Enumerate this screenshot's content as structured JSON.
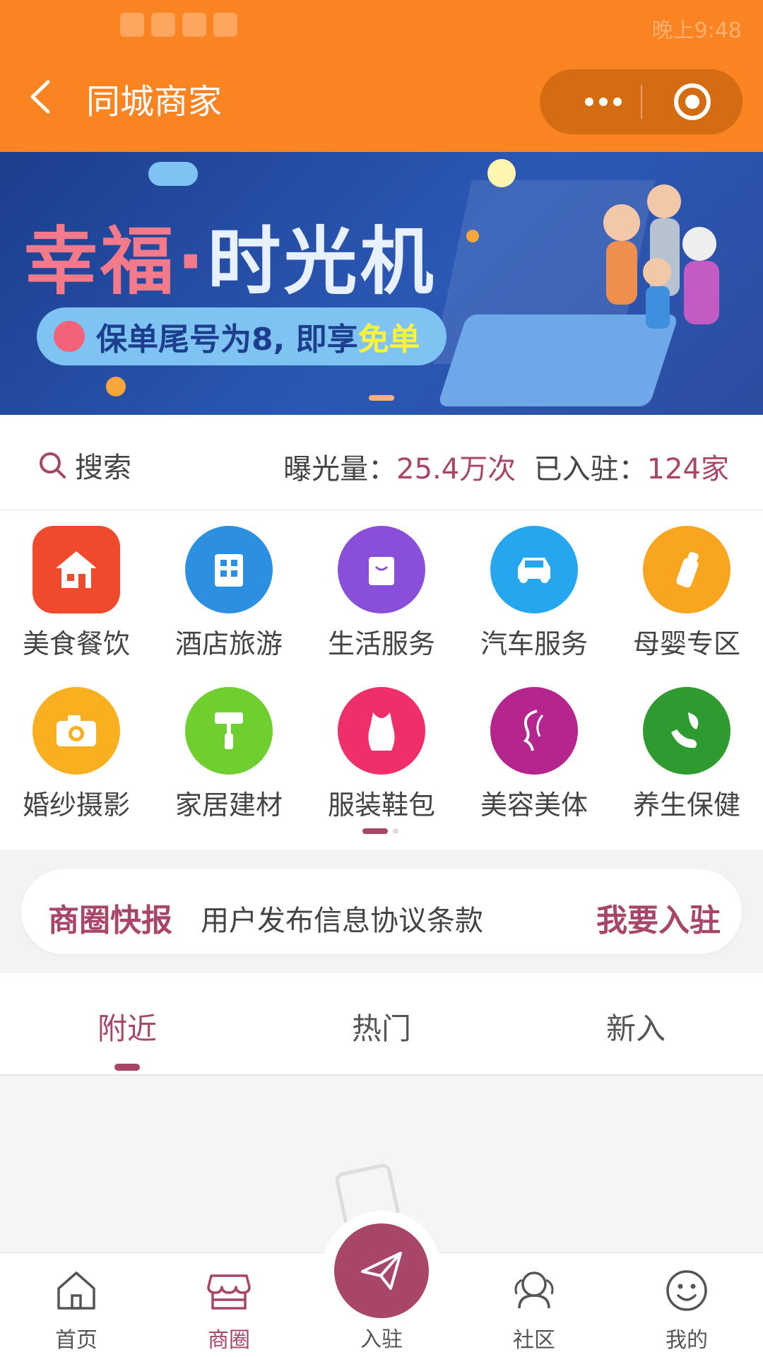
{
  "status_bar": {
    "carrier": "",
    "time": "晚上9:48"
  },
  "header": {
    "title": "同城商家"
  },
  "banner": {
    "title_part1": "幸福·",
    "title_part2": "时光机",
    "subtitle": "保单尾号为8, 即享",
    "subtitle_highlight": "免单"
  },
  "stats": {
    "search_label": "搜索",
    "exposure_label": "曝光量：",
    "exposure_value": "25.4万次",
    "joined_label": "已入驻：",
    "joined_value": "124家"
  },
  "categories": [
    {
      "label": "美食餐饮",
      "color": "#f04a2c",
      "icon": "house-icon"
    },
    {
      "label": "酒店旅游",
      "color": "#2d8fe0",
      "icon": "building-icon"
    },
    {
      "label": "生活服务",
      "color": "#8a4fd8",
      "icon": "bag-icon"
    },
    {
      "label": "汽车服务",
      "color": "#25a6ef",
      "icon": "car-icon"
    },
    {
      "label": "母婴专区",
      "color": "#f8a620",
      "icon": "baby-bottle-icon"
    },
    {
      "label": "婚纱摄影",
      "color": "#f8b020",
      "icon": "camera-icon"
    },
    {
      "label": "家居建材",
      "color": "#6fcf2f",
      "icon": "paint-roller-icon"
    },
    {
      "label": "服装鞋包",
      "color": "#f02e6a",
      "icon": "clothing-icon"
    },
    {
      "label": "美容美体",
      "color": "#b4258e",
      "icon": "woman-face-icon"
    },
    {
      "label": "养生保健",
      "color": "#2f9a2f",
      "icon": "leaf-hand-icon"
    }
  ],
  "notice": {
    "tag": "商圈快报",
    "message": "用户发布信息协议条款",
    "action": "我要入驻"
  },
  "tabs": [
    "附近",
    "热门",
    "新入"
  ],
  "bottom_nav": {
    "home": "首页",
    "business": "商圈",
    "join": "入驻",
    "community": "社区",
    "mine": "我的"
  },
  "colors": {
    "header": "#fb8422",
    "accent": "#a8466a"
  }
}
